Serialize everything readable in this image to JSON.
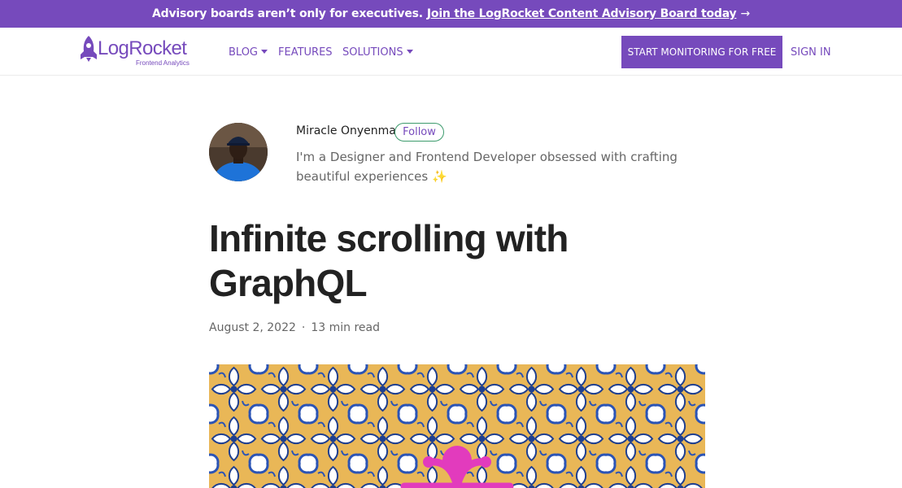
{
  "banner": {
    "text": "Advisory boards aren’t only for executives.",
    "link": "Join the LogRocket Content Advisory Board today",
    "arrow": "→"
  },
  "nav": {
    "logo_name": "LogRocket",
    "logo_tagline": "Frontend Analytics",
    "items": [
      {
        "label": "BLOG",
        "dropdown": true
      },
      {
        "label": "FEATURES",
        "dropdown": false
      },
      {
        "label": "SOLUTIONS",
        "dropdown": true
      }
    ],
    "cta_label": "START MONITORING FOR FREE",
    "signin_label": "SIGN IN"
  },
  "author": {
    "name": "Miracle Onyenma",
    "follow_label": "Follow",
    "bio": "I'm a Designer and Frontend Developer obsessed with crafting beautiful experiences ✨"
  },
  "article": {
    "title": "Infinite scrolling with GraphQL",
    "date": "August 2, 2022",
    "separator": "·",
    "read_time": "13 min read"
  },
  "colors": {
    "brand": "#764abc",
    "follow_border": "#3d9b6d"
  },
  "icons": {
    "logo": "rocket-icon",
    "arrow": "arrow-right-icon",
    "caret": "caret-down-icon"
  }
}
